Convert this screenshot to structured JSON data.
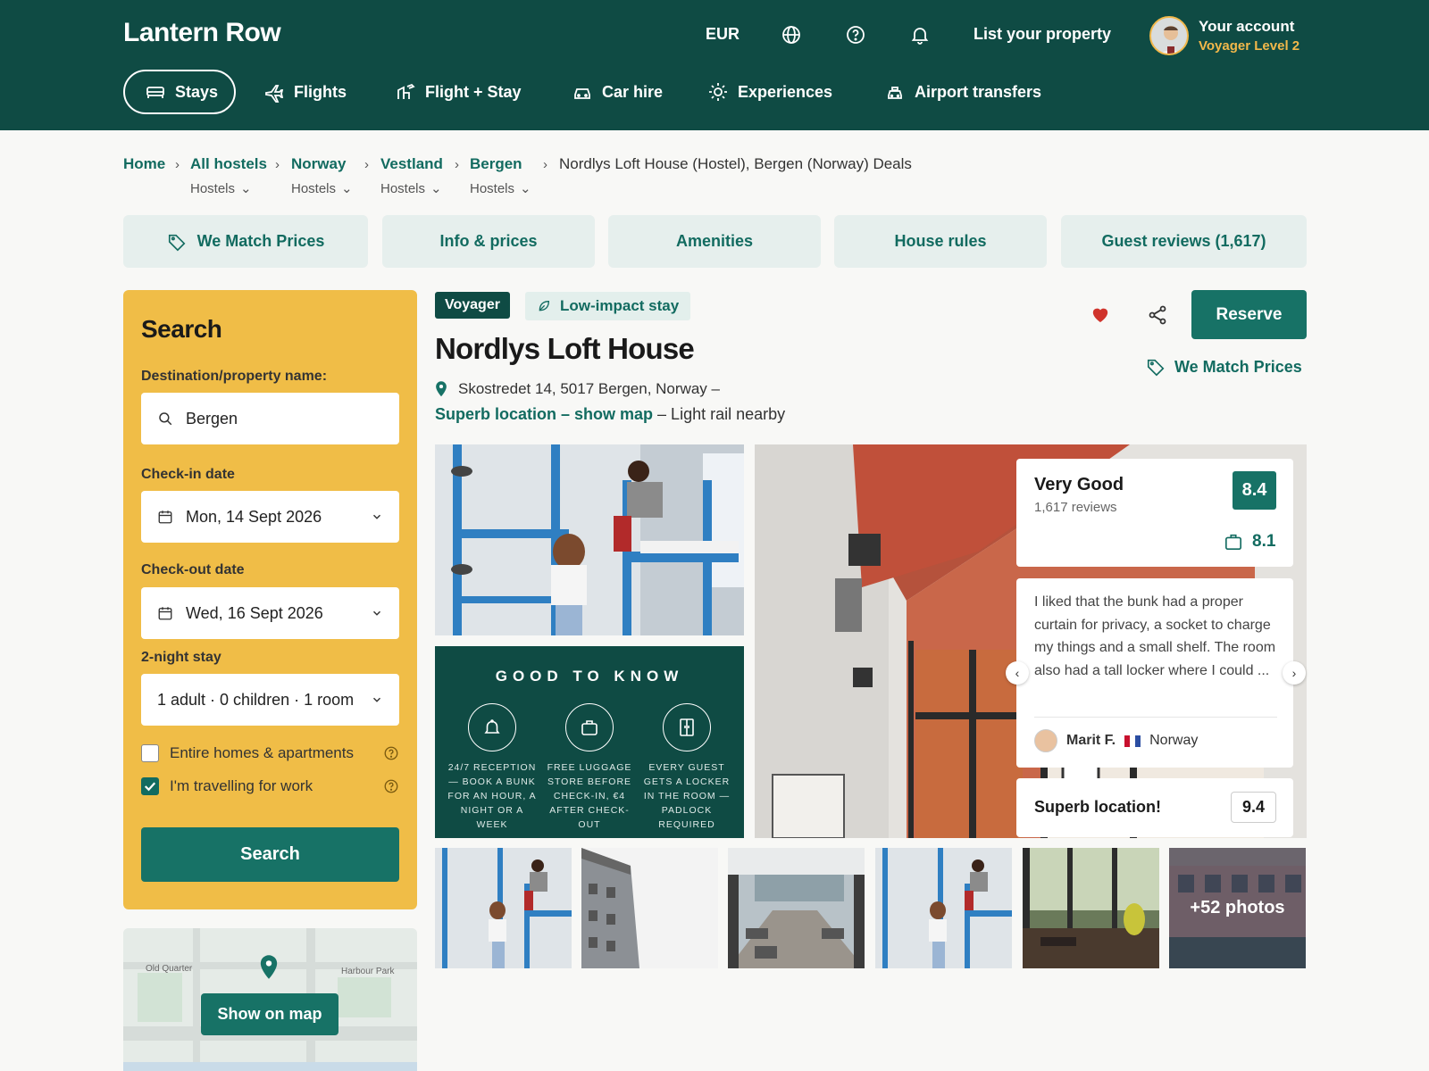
{
  "header": {
    "logo": "Lantern Row",
    "currency": "EUR",
    "list_property": "List your property",
    "account_name": "Your account",
    "account_level": "Voyager Level 2"
  },
  "nav": [
    {
      "label": "Stays",
      "icon": "bed-icon"
    },
    {
      "label": "Flights",
      "icon": "plane-icon"
    },
    {
      "label": "Flight + Stay",
      "icon": "flight-hotel-icon"
    },
    {
      "label": "Car hire",
      "icon": "car-icon"
    },
    {
      "label": "Experiences",
      "icon": "sun-icon"
    },
    {
      "label": "Airport transfers",
      "icon": "taxi-icon"
    }
  ],
  "breadcrumb": {
    "items": [
      {
        "label": "Home",
        "sub": ""
      },
      {
        "label": "All hostels",
        "sub": "Hostels"
      },
      {
        "label": "Norway",
        "sub": "Hostels"
      },
      {
        "label": "Vestland",
        "sub": "Hostels"
      },
      {
        "label": "Bergen",
        "sub": "Hostels"
      }
    ],
    "current": "Nordlys Loft House (Hostel), Bergen (Norway) Deals"
  },
  "tabs": [
    {
      "label": "We Match Prices"
    },
    {
      "label": "Info & prices"
    },
    {
      "label": "Amenities"
    },
    {
      "label": "House rules"
    },
    {
      "label": "Guest reviews (1,617)"
    }
  ],
  "search": {
    "title": "Search",
    "destination_label": "Destination/property name:",
    "destination_value": "Bergen",
    "checkin_label": "Check-in date",
    "checkin_value": "Mon, 14 Sept 2026",
    "checkout_label": "Check-out date",
    "checkout_value": "Wed, 16 Sept 2026",
    "stay_label": "2-night stay",
    "guests_value": "1 adult · 0 children · 1 room",
    "option_homes": "Entire homes & apartments",
    "option_homes_checked": false,
    "option_work": "I'm travelling for work",
    "option_work_checked": true,
    "button": "Search"
  },
  "map": {
    "button": "Show on map",
    "label_left": "Old Quarter",
    "label_right": "Harbour Park"
  },
  "property": {
    "badge_tier": "Voyager",
    "badge_eco": "Low-impact stay",
    "name": "Nordlys Loft House",
    "address": "Skostredet 14, 5017 Bergen, Norway –",
    "location_link": "Superb location – show map",
    "location_note": " – Light rail nearby",
    "reserve": "Reserve",
    "match_prices": "We Match Prices"
  },
  "good_to_know": {
    "title": "GOOD TO KNOW",
    "items": [
      {
        "icon": "bell-icon",
        "text": "24/7 reception — book a bunk for an hour, a night or a week"
      },
      {
        "icon": "luggage-icon",
        "text": "Free luggage store before check-in, €4 after check-out"
      },
      {
        "icon": "locker-icon",
        "text": "Every guest gets a locker in the room — padlock required"
      }
    ]
  },
  "rating": {
    "label": "Very Good",
    "reviews": "1,617 reviews",
    "score": "8.4",
    "value_score": "8.1"
  },
  "review": {
    "text": "I liked that the bunk had a proper curtain for privacy, a socket to charge my things and a small shelf. The room also had a tall locker where I could ...",
    "author": "Marit F.",
    "country": "Norway"
  },
  "location_score": {
    "label": "Superb location!",
    "score": "9.4"
  },
  "gallery": {
    "more_photos": "+52 photos"
  },
  "colors": {
    "header_bg": "#0f4b44",
    "accent": "#177266",
    "search_panel": "#f0bd47",
    "level_gold": "#f2b84a",
    "heart": "#d0342c"
  }
}
